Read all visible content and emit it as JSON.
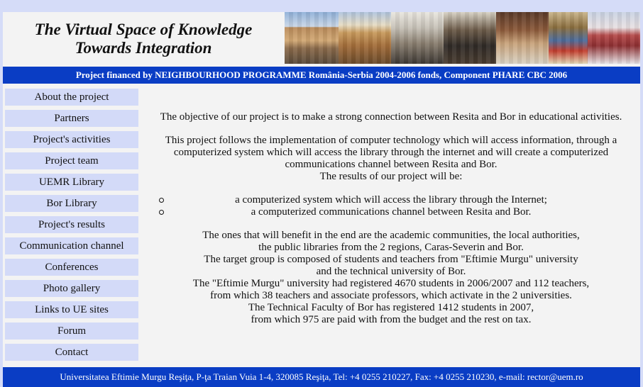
{
  "header": {
    "title_line1": "The Virtual Space of Knowledge",
    "title_line2": "Towards Integration"
  },
  "photos": [
    "building-photo",
    "building-photo",
    "library-photo",
    "library-photo",
    "library-photo",
    "library-photo",
    "building-photo"
  ],
  "banner": "Project financed by NEIGHBOURHOOD PROGRAMME România-Serbia 2004-2006 fonds, Component PHARE CBC 2006",
  "nav": {
    "items": [
      {
        "label": "About the project"
      },
      {
        "label": "Partners"
      },
      {
        "label": "Project's activities"
      },
      {
        "label": "Project team"
      },
      {
        "label": "UEMR Library"
      },
      {
        "label": "Bor Library"
      },
      {
        "label": "Project's results"
      },
      {
        "label": "Communication channel"
      },
      {
        "label": "Conferences"
      },
      {
        "label": "Photo gallery"
      },
      {
        "label": "Links to UE sites"
      },
      {
        "label": "Forum"
      },
      {
        "label": "Contact"
      }
    ]
  },
  "main": {
    "objective": "The objective of our project is to make a strong connection between Resita and Bor in educational activities.",
    "follows": [
      "This project follows the implementation of computer technology which will access information, through a",
      "computerized system which will access the library through the internet and will create a computerized",
      "communications channel between Resita and Bor.",
      "The results of our project will be:"
    ],
    "results": [
      "a computerized system which will access the library through the Internet;",
      "a computerized communications channel between Resita and Bor."
    ],
    "benefit": [
      "The ones that will benefit in the end are the academic communities, the local authorities,",
      "the public libraries from the 2 regions, Caras-Severin and Bor.",
      "The target group is composed of students and teachers from \"Eftimie Murgu\" university",
      "and the technical university of Bor.",
      "The \"Eftimie Murgu\" university had registered 4670 students in 2006/2007 and 112 teachers,",
      "from which 38 teachers and associate professors, which activate in the 2 universities.",
      "The Technical Faculty of Bor has registered 1412 students in 2007,",
      "from which 975 are paid with from the budget and the rest on tax."
    ]
  },
  "footer": "Universitatea Eftimie Murgu Reşiţa, P-ţa Traian Vuia 1-4, 320085 Reşiţa, Tel: +4 0255 210227, Fax: +4 0255 210230, e-mail: rector@uem.ro",
  "colors": {
    "page_bg": "#d5dcf8",
    "content_bg": "#f3f3f3",
    "banner_bg": "#0a3dc4",
    "nav_item_bg": "#d3daf8"
  }
}
